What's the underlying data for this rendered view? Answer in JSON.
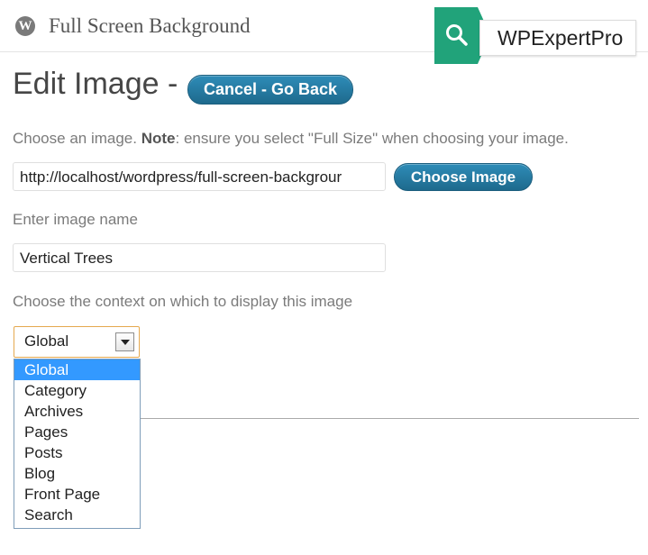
{
  "header": {
    "logo_glyph": "W",
    "plugin_title": "Full Screen Background",
    "badge_text": "WPExpertPro",
    "badge_icon": "search-icon",
    "accent": "#21a37a"
  },
  "page": {
    "heading": "Edit Image -",
    "cancel_label": "Cancel - Go Back"
  },
  "form": {
    "choose_prefix": "Choose an image.",
    "choose_note_label": "Note",
    "choose_note_text": ": ensure you select \"Full Size\" when choosing your image.",
    "image_url_value": "http://localhost/wordpress/full-screen-backgrour",
    "choose_image_label": "Choose Image",
    "name_label": "Enter image name",
    "name_value": "Vertical Trees",
    "context_label": "Choose the context on which to display this image",
    "context_selected": "Global",
    "context_options": [
      "Global",
      "Category",
      "Archives",
      "Pages",
      "Posts",
      "Blog",
      "Front Page",
      "Search"
    ]
  },
  "colors": {
    "button": "#21759b",
    "option_highlight": "#3399ff"
  }
}
